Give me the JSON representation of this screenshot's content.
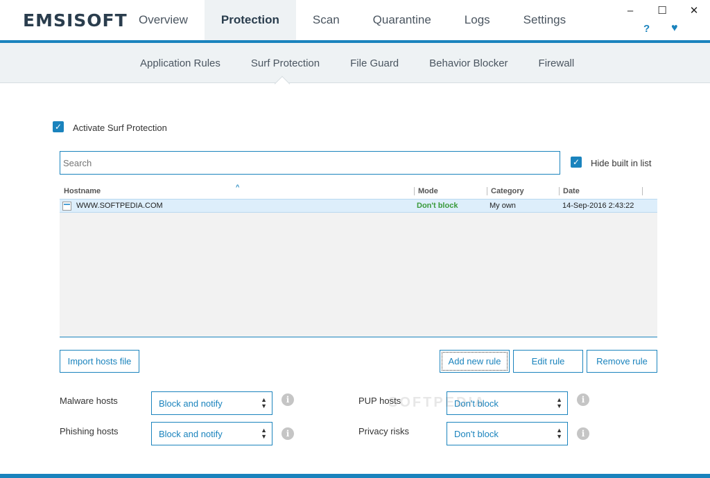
{
  "app": {
    "logo": "EMSISOFT"
  },
  "tabs": [
    {
      "label": "Overview"
    },
    {
      "label": "Protection"
    },
    {
      "label": "Scan"
    },
    {
      "label": "Quarantine"
    },
    {
      "label": "Logs"
    },
    {
      "label": "Settings"
    }
  ],
  "window": {
    "minimize": "–",
    "maximize": "☐",
    "close": "✕",
    "help": "?",
    "heart": "♥"
  },
  "subtabs": [
    {
      "label": "Application Rules"
    },
    {
      "label": "Surf Protection"
    },
    {
      "label": "File Guard"
    },
    {
      "label": "Behavior Blocker"
    },
    {
      "label": "Firewall"
    }
  ],
  "surf": {
    "activate_label": "Activate Surf Protection",
    "search_placeholder": "Search",
    "hide_builtin_label": "Hide built in list"
  },
  "list": {
    "columns": [
      "Hostname",
      "Mode",
      "Category",
      "Date"
    ],
    "rows": [
      {
        "hostname": "WWW.SOFTPEDIA.COM",
        "mode": "Don't block",
        "category": "My own",
        "date": "14-Sep-2016 2:43:22"
      }
    ]
  },
  "buttons": {
    "import": "Import hosts file",
    "add": "Add new rule",
    "edit": "Edit rule",
    "remove": "Remove rule"
  },
  "settings": {
    "malware": {
      "label": "Malware hosts",
      "value": "Block and notify"
    },
    "phishing": {
      "label": "Phishing hosts",
      "value": "Block and notify"
    },
    "pup": {
      "label": "PUP hosts",
      "value": "Don't block"
    },
    "privacy": {
      "label": "Privacy risks",
      "value": "Don't block"
    }
  },
  "watermark": "SOFTPEDIA",
  "colors": {
    "accent": "#1a83bd",
    "green": "#3a9a3a"
  }
}
